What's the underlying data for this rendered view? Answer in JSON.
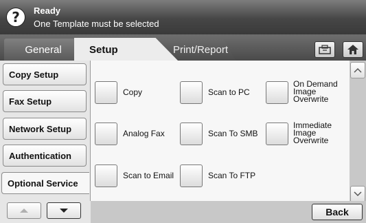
{
  "status": {
    "title": "Ready",
    "message": "One Template must be selected",
    "icon": "help-question-icon"
  },
  "tabs": [
    {
      "label": "General"
    },
    {
      "label": "Setup"
    },
    {
      "label": "Print/Report"
    }
  ],
  "active_tab": "Setup",
  "toolbar": {
    "icons": [
      "job-status-icon",
      "home-icon"
    ]
  },
  "sidebar": {
    "items": [
      {
        "label": "Copy Setup"
      },
      {
        "label": "Fax Setup"
      },
      {
        "label": "Network Setup"
      },
      {
        "label": "Authentication"
      },
      {
        "label": "Optional Service"
      }
    ],
    "active": "Optional Service"
  },
  "options": [
    {
      "label": "Copy"
    },
    {
      "label": "Scan to PC"
    },
    {
      "label": "On Demand Image Overwrite"
    },
    {
      "label": "Analog Fax"
    },
    {
      "label": "Scan To SMB"
    },
    {
      "label": "Immediate Image Overwrite"
    },
    {
      "label": "Scan to Email"
    },
    {
      "label": "Scan To FTP"
    }
  ],
  "footer": {
    "back_label": "Back"
  },
  "colors": {
    "header": "#464646",
    "panel": "#e6e6e6",
    "content": "#f7f7f7"
  }
}
